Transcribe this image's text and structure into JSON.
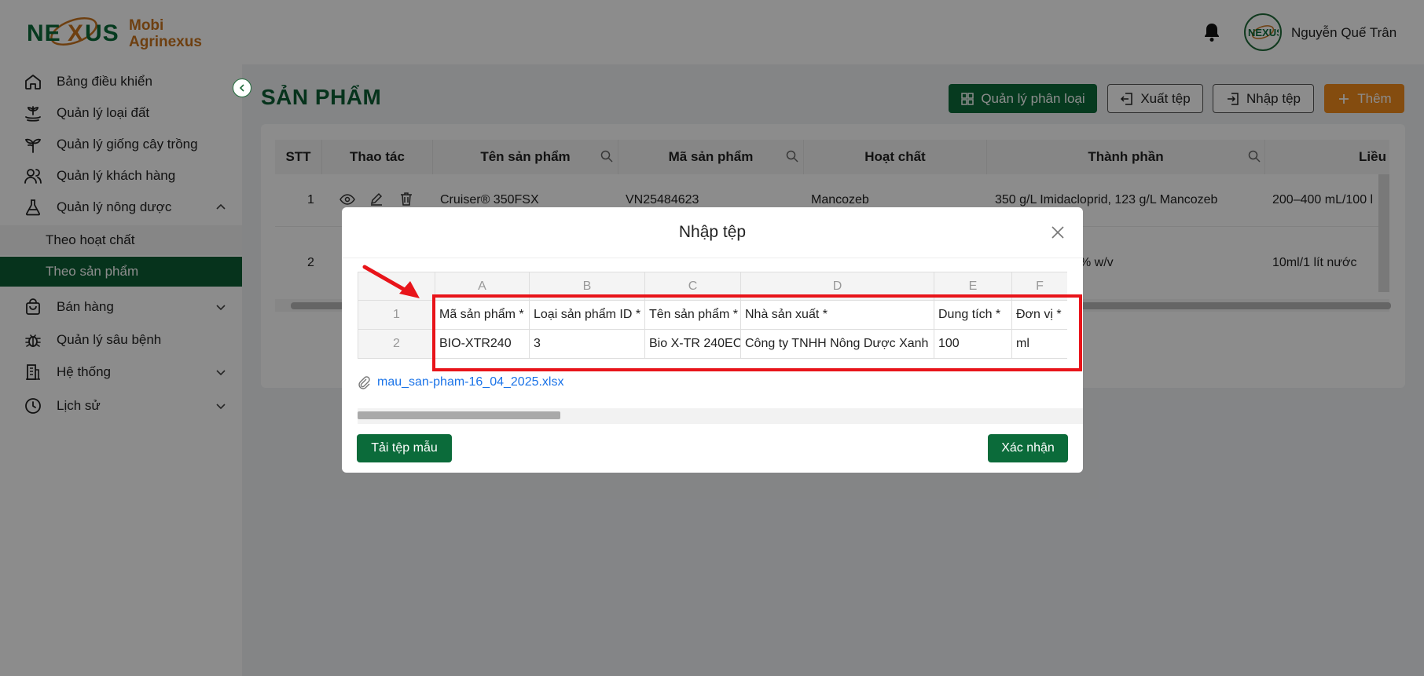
{
  "header": {
    "brand_line1": "Mobi",
    "brand_line2": "Agrinexus",
    "logo_text": "NEXUS",
    "username": "Nguyễn Quế Trân"
  },
  "sidebar": {
    "items": [
      {
        "label": "Bảng điều khiển",
        "icon": "home-icon"
      },
      {
        "label": "Quản lý loại đất",
        "icon": "soil-icon"
      },
      {
        "label": "Quản lý giống cây trồng",
        "icon": "plant-icon"
      },
      {
        "label": "Quản lý khách hàng",
        "icon": "users-icon"
      },
      {
        "label": "Quản lý nông dược",
        "icon": "flask-icon"
      },
      {
        "label": "Bán hàng",
        "icon": "shopping-bag-icon"
      },
      {
        "label": "Quản lý sâu bệnh",
        "icon": "bug-icon"
      },
      {
        "label": "Hệ thống",
        "icon": "building-icon"
      },
      {
        "label": "Lịch sử",
        "icon": "clock-icon"
      }
    ],
    "sub_items": [
      {
        "label": "Theo hoạt chất"
      },
      {
        "label": "Theo sản phẩm"
      }
    ]
  },
  "page": {
    "title": "SẢN PHẨM",
    "buttons": {
      "manage_category": "Quản lý phân loại",
      "export": "Xuất tệp",
      "import": "Nhập tệp",
      "add": "Thêm"
    }
  },
  "table": {
    "columns": [
      "STT",
      "Thao tác",
      "Tên sản phẩm",
      "Mã sản phẩm",
      "Hoạt chất",
      "Thành phần",
      "Liều"
    ],
    "rows": [
      {
        "stt": "1",
        "name": "Cruiser® 350FSX",
        "code": "VN25484623",
        "active": "Mancozeb",
        "composition": "350 g/L Imidacloprid, 123 g/L Mancozeb",
        "dose": "200–400 mL/100 l"
      },
      {
        "stt": "2",
        "name": "",
        "code": "",
        "active": "",
        "composition": "% w/v",
        "dose": "10ml/1 lít nước"
      }
    ]
  },
  "modal": {
    "title": "Nhập tệp",
    "sheet": {
      "col_letters": [
        "A",
        "B",
        "C",
        "D",
        "E",
        "F"
      ],
      "row_numbers": [
        "1",
        "2"
      ],
      "headers": [
        "Mã sản phẩm *",
        "Loại sản phẩm ID *",
        "Tên sản phẩm *",
        "Nhà sản xuất *",
        "Dung tích *",
        "Đơn vị *"
      ],
      "values": [
        "BIO-XTR240",
        "3",
        "Bio X-TR 240EC",
        "Công ty TNHH Nông Dược Xanh",
        "100",
        "ml"
      ]
    },
    "file_name": "mau_san-pham-16_04_2025.xlsx",
    "download_template": "Tải tệp mẫu",
    "confirm": "Xác nhận"
  },
  "colors": {
    "primary_green": "#0b6b3a",
    "accent_orange": "#f08a1c",
    "highlight_red": "#e8141a",
    "link_blue": "#1a73e8"
  }
}
